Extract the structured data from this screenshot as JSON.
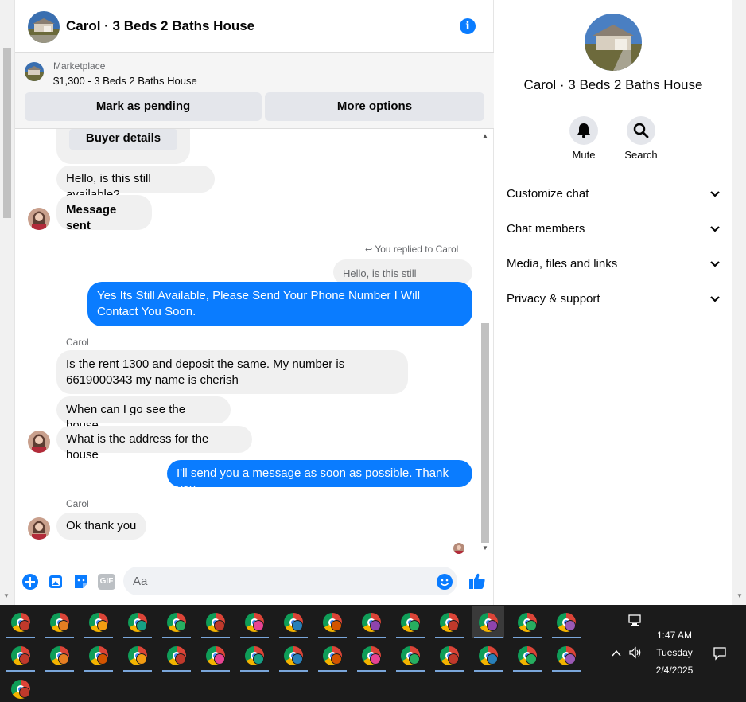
{
  "chat": {
    "title": "Carol · 3 Beds 2 Baths House",
    "marketplace_label": "Marketplace",
    "listing": "$1,300 - 3 Beds 2 Baths House",
    "mark_pending": "Mark as pending",
    "more_options": "More options",
    "buyer_details": "Buyer details",
    "messages": [
      {
        "text": "Hello, is this still available?"
      },
      {
        "text": "Message sent"
      },
      {
        "text": "You replied to Carol"
      },
      {
        "text": "Hello, is this still available?"
      },
      {
        "text": "Yes Its Still Available, Please Send Your Phone Number I Will Contact You Soon."
      },
      {
        "text": "Carol"
      },
      {
        "text": "Is the rent 1300 and deposit the same. My number is 6619000343 my name is cherish"
      },
      {
        "text": "When can I go see the house."
      },
      {
        "text": "What is the address for the house"
      },
      {
        "text": "I'll send you a message as soon as possible. Thank you"
      },
      {
        "text": "Carol"
      },
      {
        "text": "Ok thank you"
      }
    ],
    "composer_placeholder": "Aa",
    "gif_label": "GIF",
    "info_glyph": "i",
    "accent": "#0a7cff"
  },
  "panel": {
    "name": "Carol · 3 Beds 2 Baths House",
    "mute": "Mute",
    "search": "Search",
    "sections": [
      "Customize chat",
      "Chat members",
      "Media, files and links",
      "Privacy & support"
    ]
  },
  "taskbar": {
    "time": "1:47 AM",
    "day": "Tuesday",
    "date": "2/4/2025"
  }
}
